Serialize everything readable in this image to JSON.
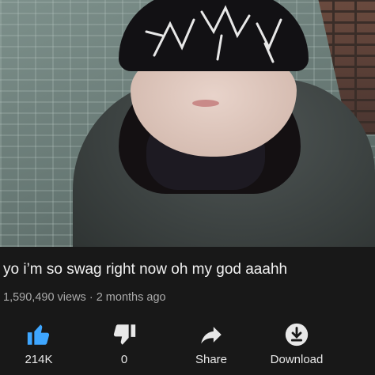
{
  "video": {
    "title": "yo i’m so swag right now oh my god aaahh",
    "views": "1,590,490 views",
    "separator": "·",
    "age": "2 months ago"
  },
  "actions": {
    "like": {
      "icon": "thumbs-up-icon",
      "count": "214K",
      "color": "#3ea6ff"
    },
    "dislike": {
      "icon": "thumbs-down-icon",
      "count": "0"
    },
    "share": {
      "icon": "share-arrow-icon",
      "label": "Share"
    },
    "download": {
      "icon": "download-icon",
      "label": "Download"
    }
  },
  "colors": {
    "background": "#181818",
    "text_primary": "#f1f1f1",
    "text_secondary": "#aaaaaa",
    "accent": "#3ea6ff"
  }
}
